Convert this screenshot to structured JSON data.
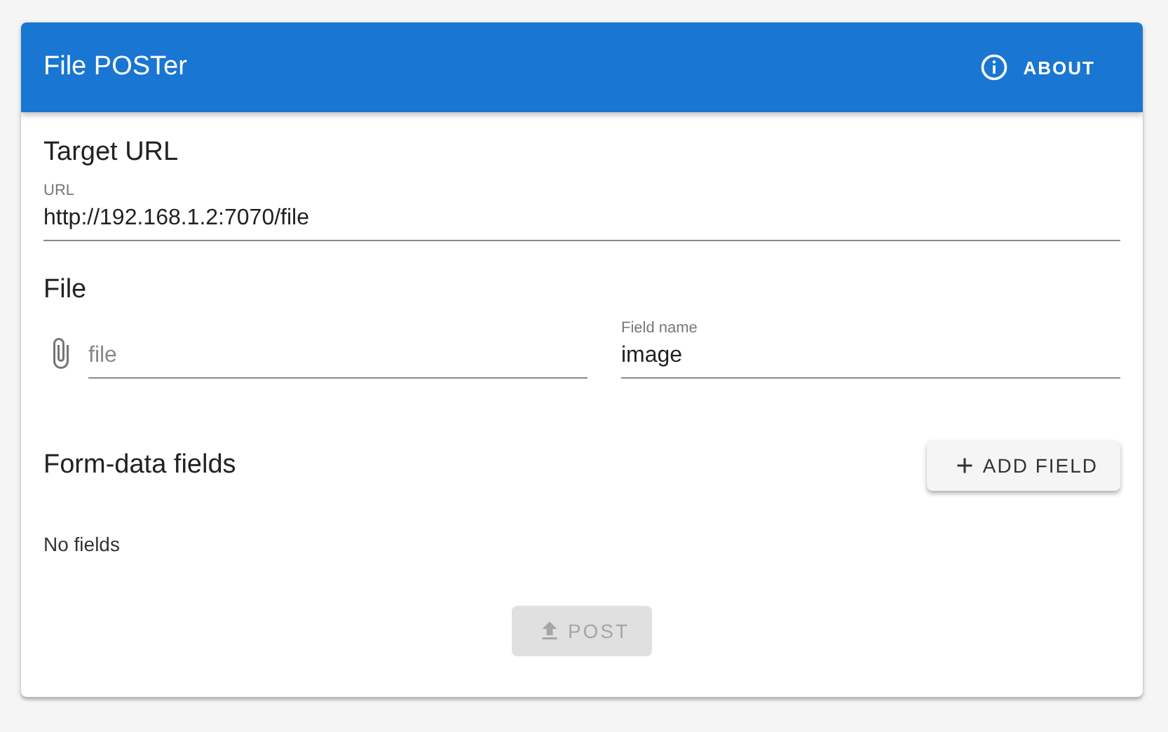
{
  "app_bar": {
    "title": "File POSTer",
    "about_button": "ABOUT"
  },
  "target_url": {
    "heading": "Target URL",
    "field": {
      "label": "URL",
      "value": "http://192.168.1.2:7070/file"
    }
  },
  "file": {
    "heading": "File",
    "file_field": {
      "placeholder": "file"
    },
    "field_name": {
      "label": "Field name",
      "value": "image"
    }
  },
  "form_data": {
    "heading": "Form-data fields",
    "add_button": "ADD FIELD",
    "empty_text": "No fields"
  },
  "post_button": {
    "label": "POST",
    "disabled": true
  }
}
